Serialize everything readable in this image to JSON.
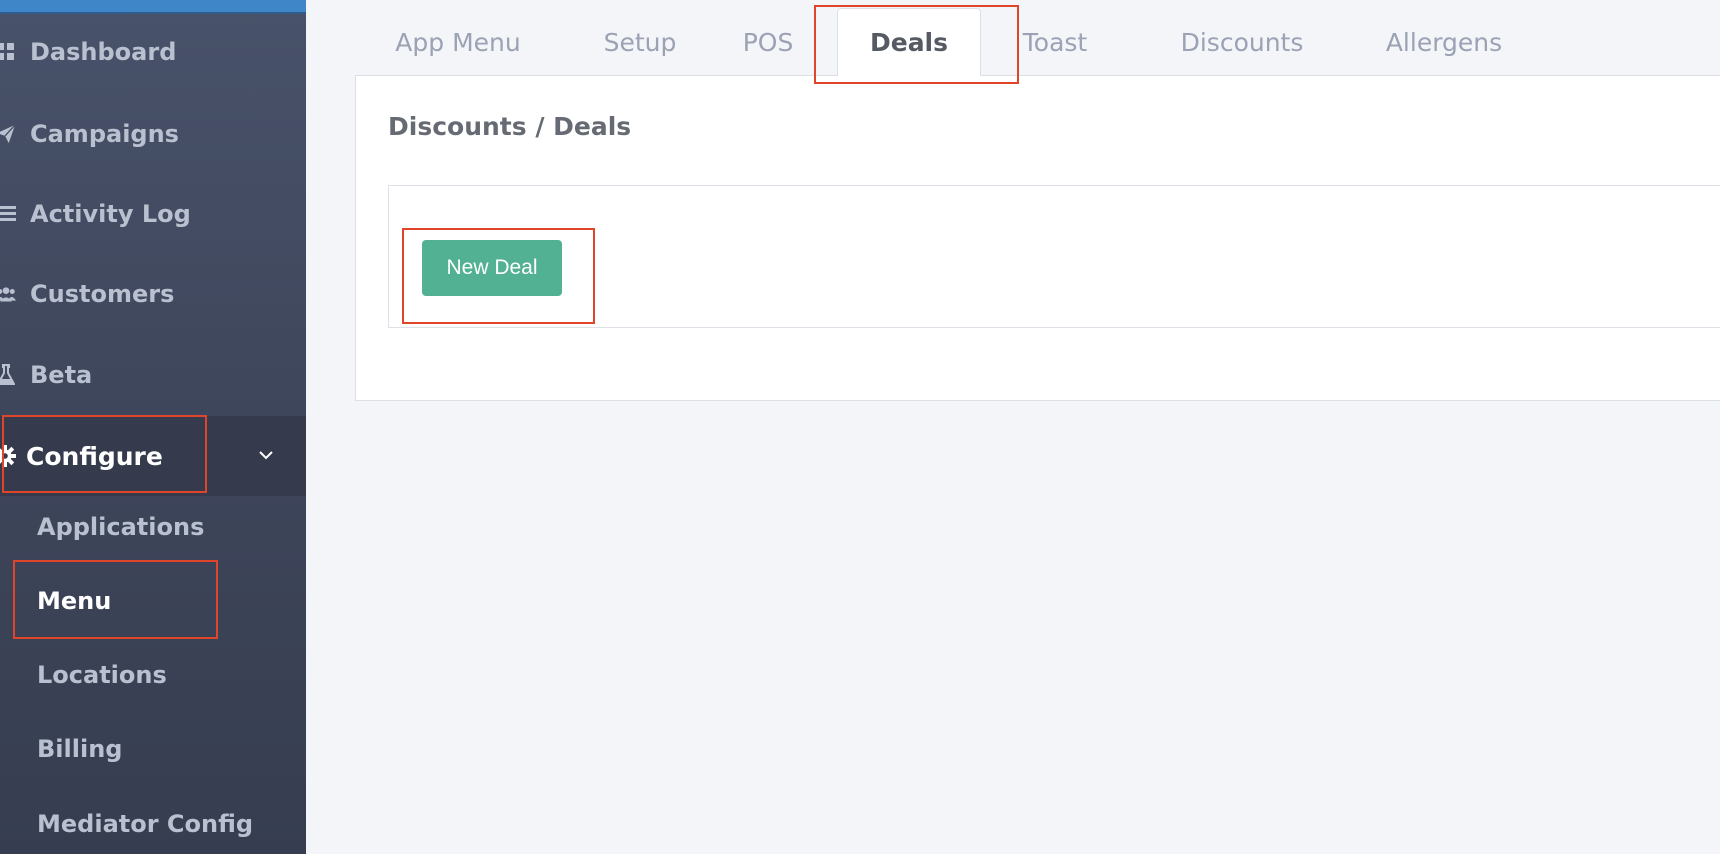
{
  "sidebar": {
    "nav_items": [
      {
        "label": "Dashboard",
        "icon": "grid-icon"
      },
      {
        "label": "Campaigns",
        "icon": "paper-plane-icon"
      },
      {
        "label": "Activity Log",
        "icon": "list-icon"
      },
      {
        "label": "Customers",
        "icon": "users-icon"
      },
      {
        "label": "Beta",
        "icon": "flask-icon"
      }
    ],
    "configure": {
      "label": "Configure",
      "icon": "gear-icon",
      "expand_icon": "chevron-down-icon"
    },
    "sub_items": [
      {
        "label": "Applications"
      },
      {
        "label": "Menu"
      },
      {
        "label": "Locations"
      },
      {
        "label": "Billing"
      },
      {
        "label": "Mediator Config"
      }
    ]
  },
  "tabs": [
    {
      "label": "App Menu"
    },
    {
      "label": "Setup"
    },
    {
      "label": "POS"
    },
    {
      "label": "Deals"
    },
    {
      "label": "Toast"
    },
    {
      "label": "Discounts"
    },
    {
      "label": "Allergens"
    }
  ],
  "active_tab": "Deals",
  "main": {
    "title": "Discounts / Deals",
    "new_deal_label": "New Deal"
  },
  "colors": {
    "sidebar_bg": "#3f475c",
    "accent_blue": "#3f86c8",
    "button_green": "#52b192",
    "highlight_red": "#e0452a"
  }
}
